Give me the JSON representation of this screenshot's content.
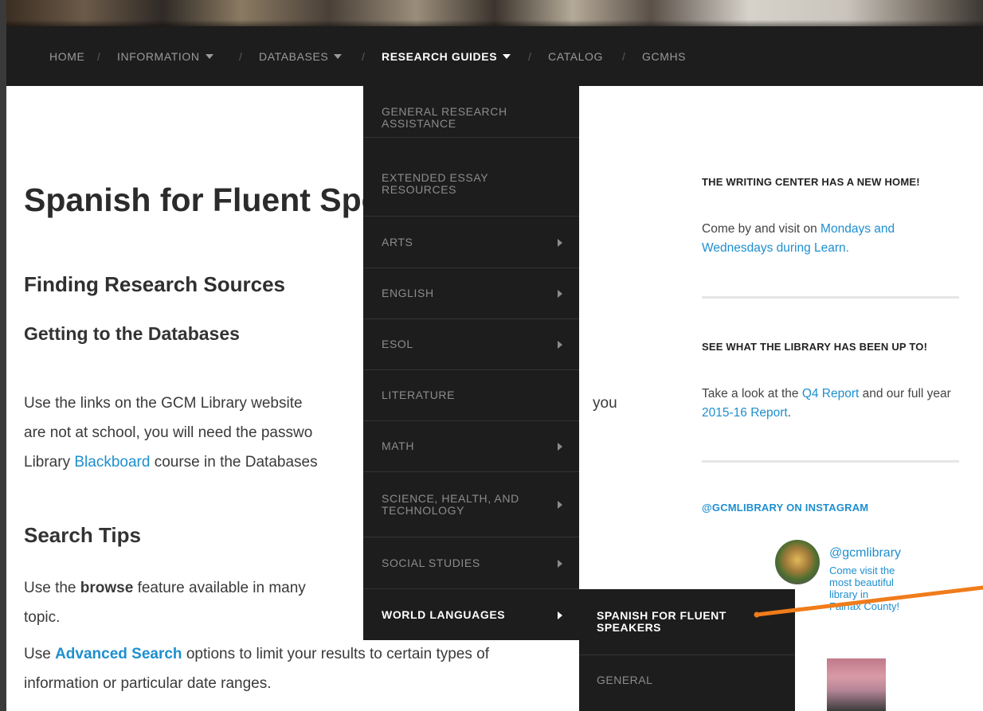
{
  "nav": {
    "items": [
      {
        "label": "HOME"
      },
      {
        "label": "INFORMATION"
      },
      {
        "label": "DATABASES"
      },
      {
        "label": "RESEARCH GUIDES"
      },
      {
        "label": "CATALOG"
      },
      {
        "label": "GCMHS"
      }
    ],
    "separator": "/"
  },
  "main": {
    "title": "Spanish for Fluent Speakers",
    "section_heading": "Finding Research Sources",
    "sub_heading": "Getting to the Databases",
    "para1": {
      "line1_start": "Use the links on the GCM Library website",
      "line1_end": "you",
      "line2_start": "are not at school, you will need the passwo",
      "line3_pre": "Library ",
      "line3_link": "Blackboard",
      "line3_post": " course in the Databases"
    },
    "search_tips_heading": "Search Tips",
    "para2": {
      "pre": "Use the ",
      "bold": "browse",
      "post": " feature available in many",
      "tail": "topic."
    },
    "para3": {
      "pre": "Use ",
      "link": "Advanced Search",
      "post": " options to limit your results to certain types of",
      "line2": "information or particular date ranges."
    }
  },
  "dropdown": {
    "items": [
      {
        "label": "GENERAL RESEARCH ASSISTANCE",
        "has_submenu": false
      },
      {
        "label": "EXTENDED ESSAY RESOURCES",
        "has_submenu": false
      },
      {
        "label": "ARTS",
        "has_submenu": true
      },
      {
        "label": "ENGLISH",
        "has_submenu": true
      },
      {
        "label": "ESOL",
        "has_submenu": true
      },
      {
        "label": "LITERATURE",
        "has_submenu": false
      },
      {
        "label": "MATH",
        "has_submenu": true
      },
      {
        "label": "SCIENCE, HEALTH, AND TECHNOLOGY",
        "has_submenu": true
      },
      {
        "label": "SOCIAL STUDIES",
        "has_submenu": true
      },
      {
        "label": "WORLD LANGUAGES",
        "has_submenu": true
      }
    ],
    "submenu": [
      {
        "label": "SPANISH FOR FLUENT SPEAKERS"
      },
      {
        "label": "GENERAL"
      }
    ]
  },
  "sidebar": {
    "writing_center": {
      "heading": "THE WRITING CENTER HAS A NEW HOME!",
      "text_pre": "Come by and visit on ",
      "link": "Mondays and Wednesdays during Learn."
    },
    "library": {
      "heading": "SEE WHAT THE LIBRARY HAS BEEN UP TO!",
      "text_pre": "Take a look at the ",
      "link1": "Q4 Report",
      "text_mid": " and our full year ",
      "link2": "2015-16 Report",
      "text_end": "."
    },
    "instagram": {
      "heading": "@GCMLIBRARY ON INSTAGRAM",
      "username": "@gcmlibrary",
      "caption": "Come visit the most beautiful library in Fairfax County!"
    }
  },
  "colors": {
    "nav_bg": "#1d1d1d",
    "link": "#1e8fcf",
    "annotation": "#f07c1a"
  }
}
